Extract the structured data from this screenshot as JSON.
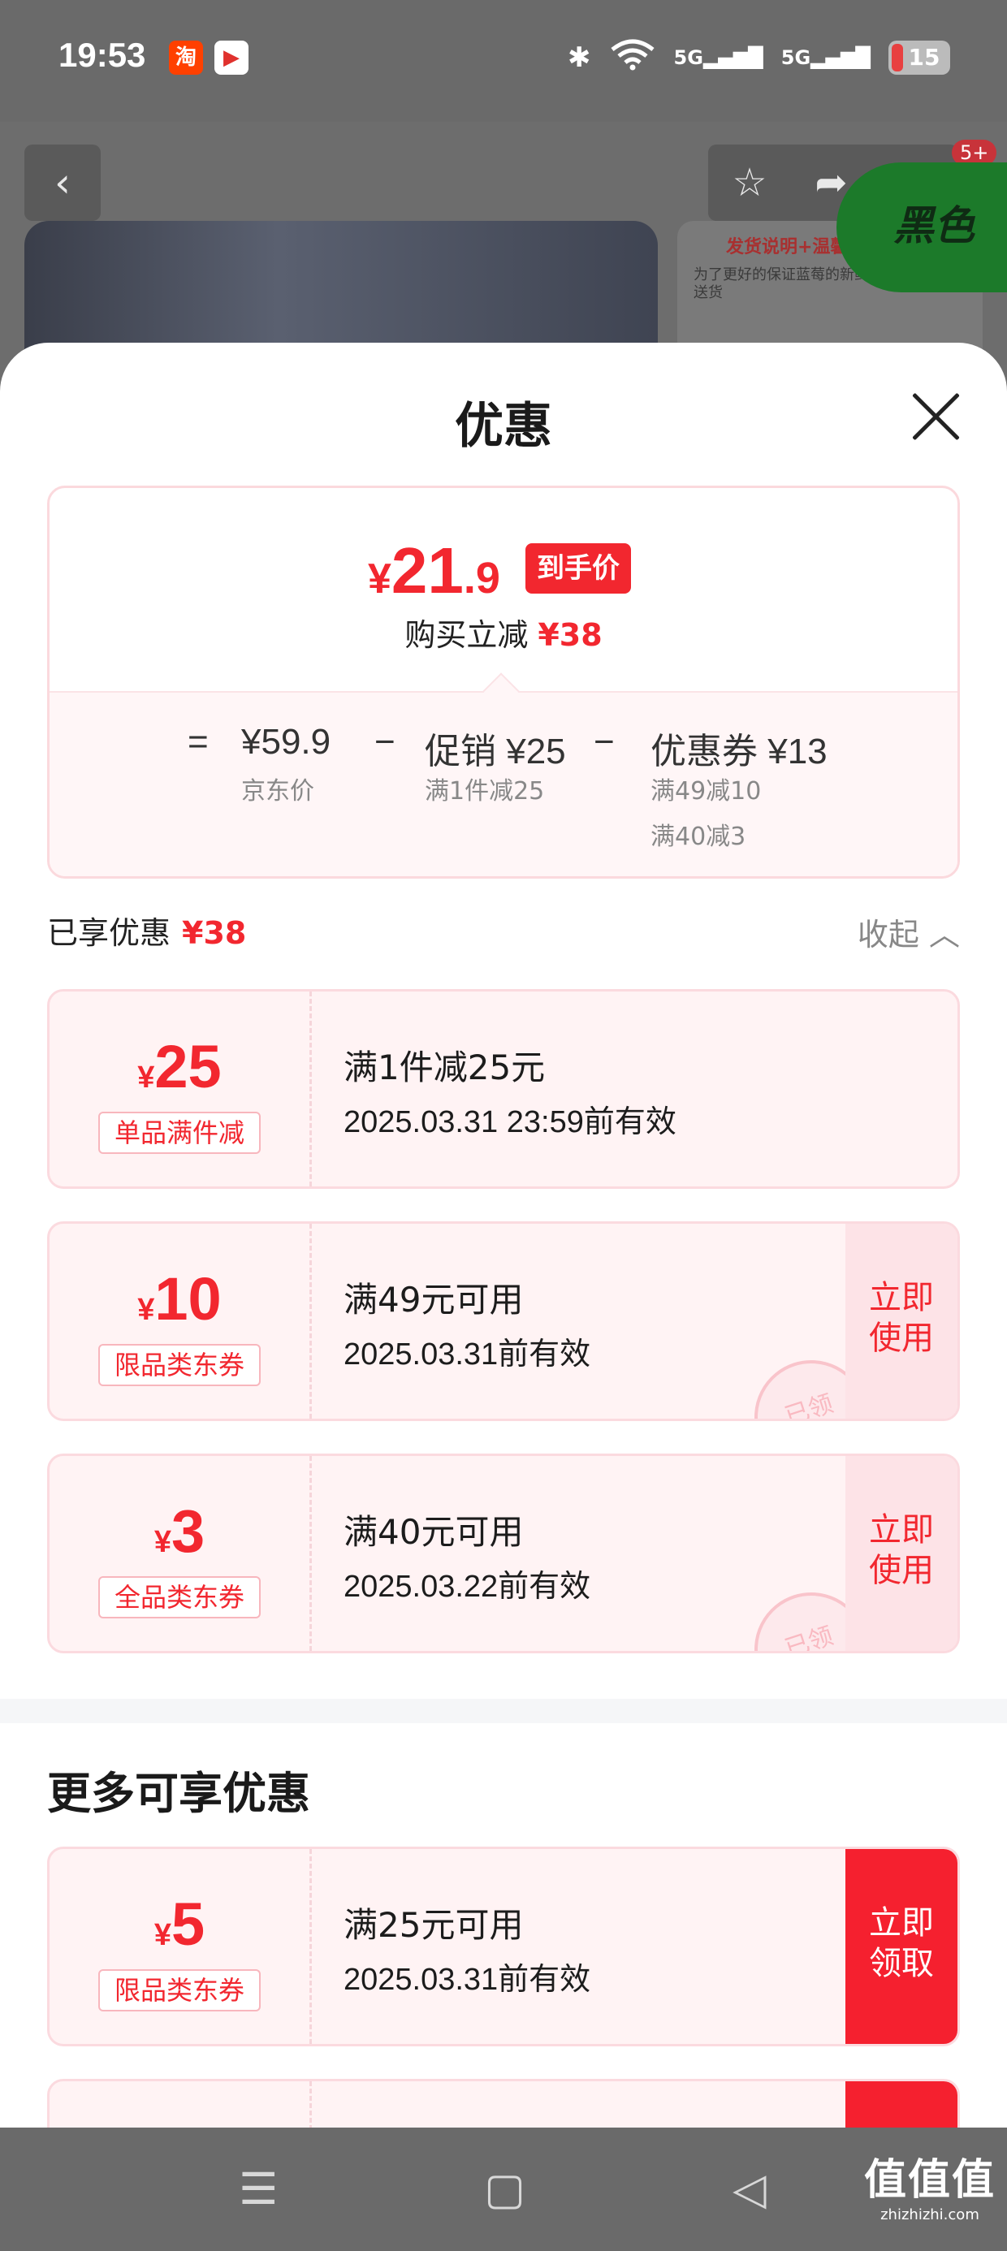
{
  "status_bar": {
    "time": "19:53",
    "app_taobao": "淘",
    "app_video": "▶",
    "signal_1": "5G",
    "signal_2": "5G",
    "battery": "15"
  },
  "background_page": {
    "notif_count": "5+",
    "promo_title": "发货说明+温馨提示",
    "promo_text": "为了更好的保证蓝莓的新鲜 直发京东快递，送货",
    "green_badge": "黑色"
  },
  "sheet": {
    "title": "优惠",
    "price_summary": {
      "currency": "¥",
      "final_int": "21",
      "final_dec": ".9",
      "final_tag": "到手价",
      "instant_label": "购买立减",
      "instant_amount": "¥38",
      "eq": "=",
      "jd_price": "¥59.9",
      "jd_price_label": "京东价",
      "minus1": "−",
      "promo": "促销 ¥25",
      "promo_sub": "满1件减25",
      "minus2": "−",
      "coupon": "优惠券 ¥13",
      "coupon_sub1": "满49减10",
      "coupon_sub2": "满40减3"
    },
    "enjoyed": {
      "label": "已享优惠",
      "amount": "¥38",
      "collapse": "收起 ︿"
    },
    "enjoyed_coupons": [
      {
        "symbol": "¥",
        "value": "25",
        "tag": "单品满件减",
        "condition": "满1件减25元",
        "validity": "2025.03.31 23:59前有效"
      },
      {
        "symbol": "¥",
        "value": "10",
        "tag": "限品类东券",
        "condition": "满49元可用",
        "validity": "2025.03.31前有效",
        "action": "立即使用",
        "stamp": "已领"
      },
      {
        "symbol": "¥",
        "value": "3",
        "tag": "全品类东券",
        "condition": "满40元可用",
        "validity": "2025.03.22前有效",
        "action": "立即使用",
        "stamp": "已领"
      }
    ],
    "more_title": "更多可享优惠",
    "more_coupons": [
      {
        "symbol": "¥",
        "value": "5",
        "tag": "限品类东券",
        "condition": "满25元可用",
        "validity": "2025.03.31前有效",
        "action": "立即领取"
      }
    ]
  },
  "bottom_nav": {
    "menu": "☰",
    "home": "▢",
    "back": "◁"
  },
  "watermark": {
    "line1": "值值值",
    "line2": "zhizhizhi.com"
  },
  "colors": {
    "accent": "#f2272f",
    "coupon_bg": "#fff3f4",
    "coupon_border": "#fbdadf"
  },
  "icons": [
    "back-icon",
    "star-icon",
    "share-icon",
    "more-icon",
    "close-icon",
    "chevron-up-icon",
    "menu-icon",
    "home-icon",
    "nav-back-icon",
    "bluetooth-icon",
    "wifi-icon"
  ]
}
